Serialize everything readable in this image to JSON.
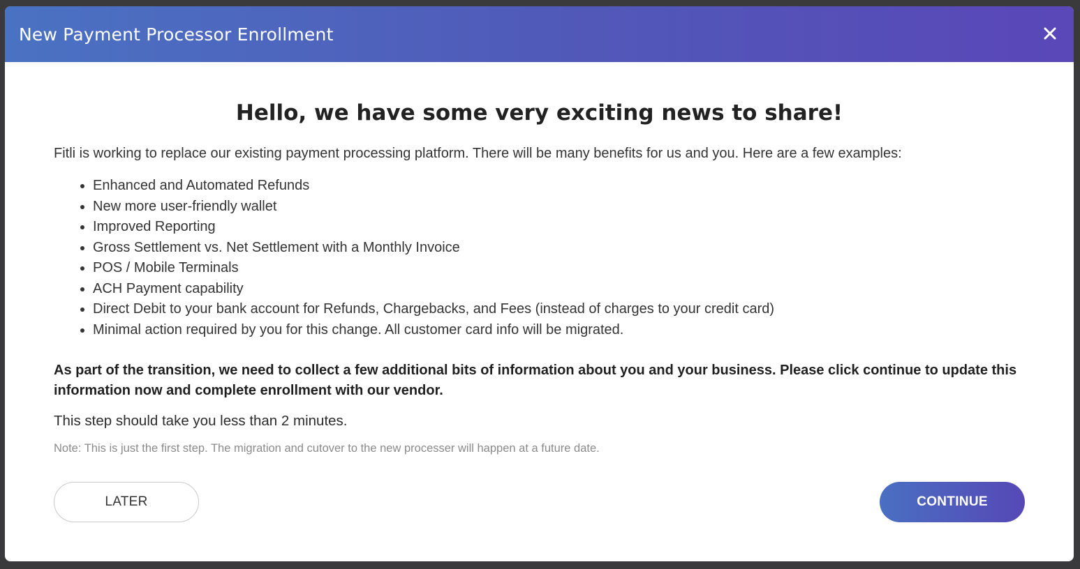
{
  "modal": {
    "title": "New Payment Processor Enrollment",
    "close_icon": "close-icon"
  },
  "content": {
    "headline": "Hello, we have some very exciting news to share!",
    "intro": "Fitli is working to replace our existing payment processing platform. There will be many benefits for us and you. Here are a few examples:",
    "benefits": [
      "Enhanced and Automated Refunds",
      "New more user-friendly wallet",
      "Improved Reporting",
      "Gross Settlement vs. Net Settlement with a Monthly Invoice",
      "POS / Mobile Terminals",
      "ACH Payment capability",
      "Direct Debit to your bank account for Refunds, Chargebacks, and Fees (instead of charges to your credit card)",
      "Minimal action required by you for this change. All customer card info will be migrated."
    ],
    "bold_paragraph": "As part of the transition, we need to collect a few additional bits of information about you and your business. Please click continue to update this information now and complete enrollment with our vendor.",
    "step_text": "This step should take you less than 2 minutes.",
    "note": "Note: This is just the first step. The migration and cutover to the new processer will happen at a future date."
  },
  "actions": {
    "later_label": "LATER",
    "continue_label": "CONTINUE"
  },
  "colors": {
    "header_start": "#4a72c3",
    "header_end": "#5a47b8",
    "backdrop": "#3a3a3c"
  }
}
